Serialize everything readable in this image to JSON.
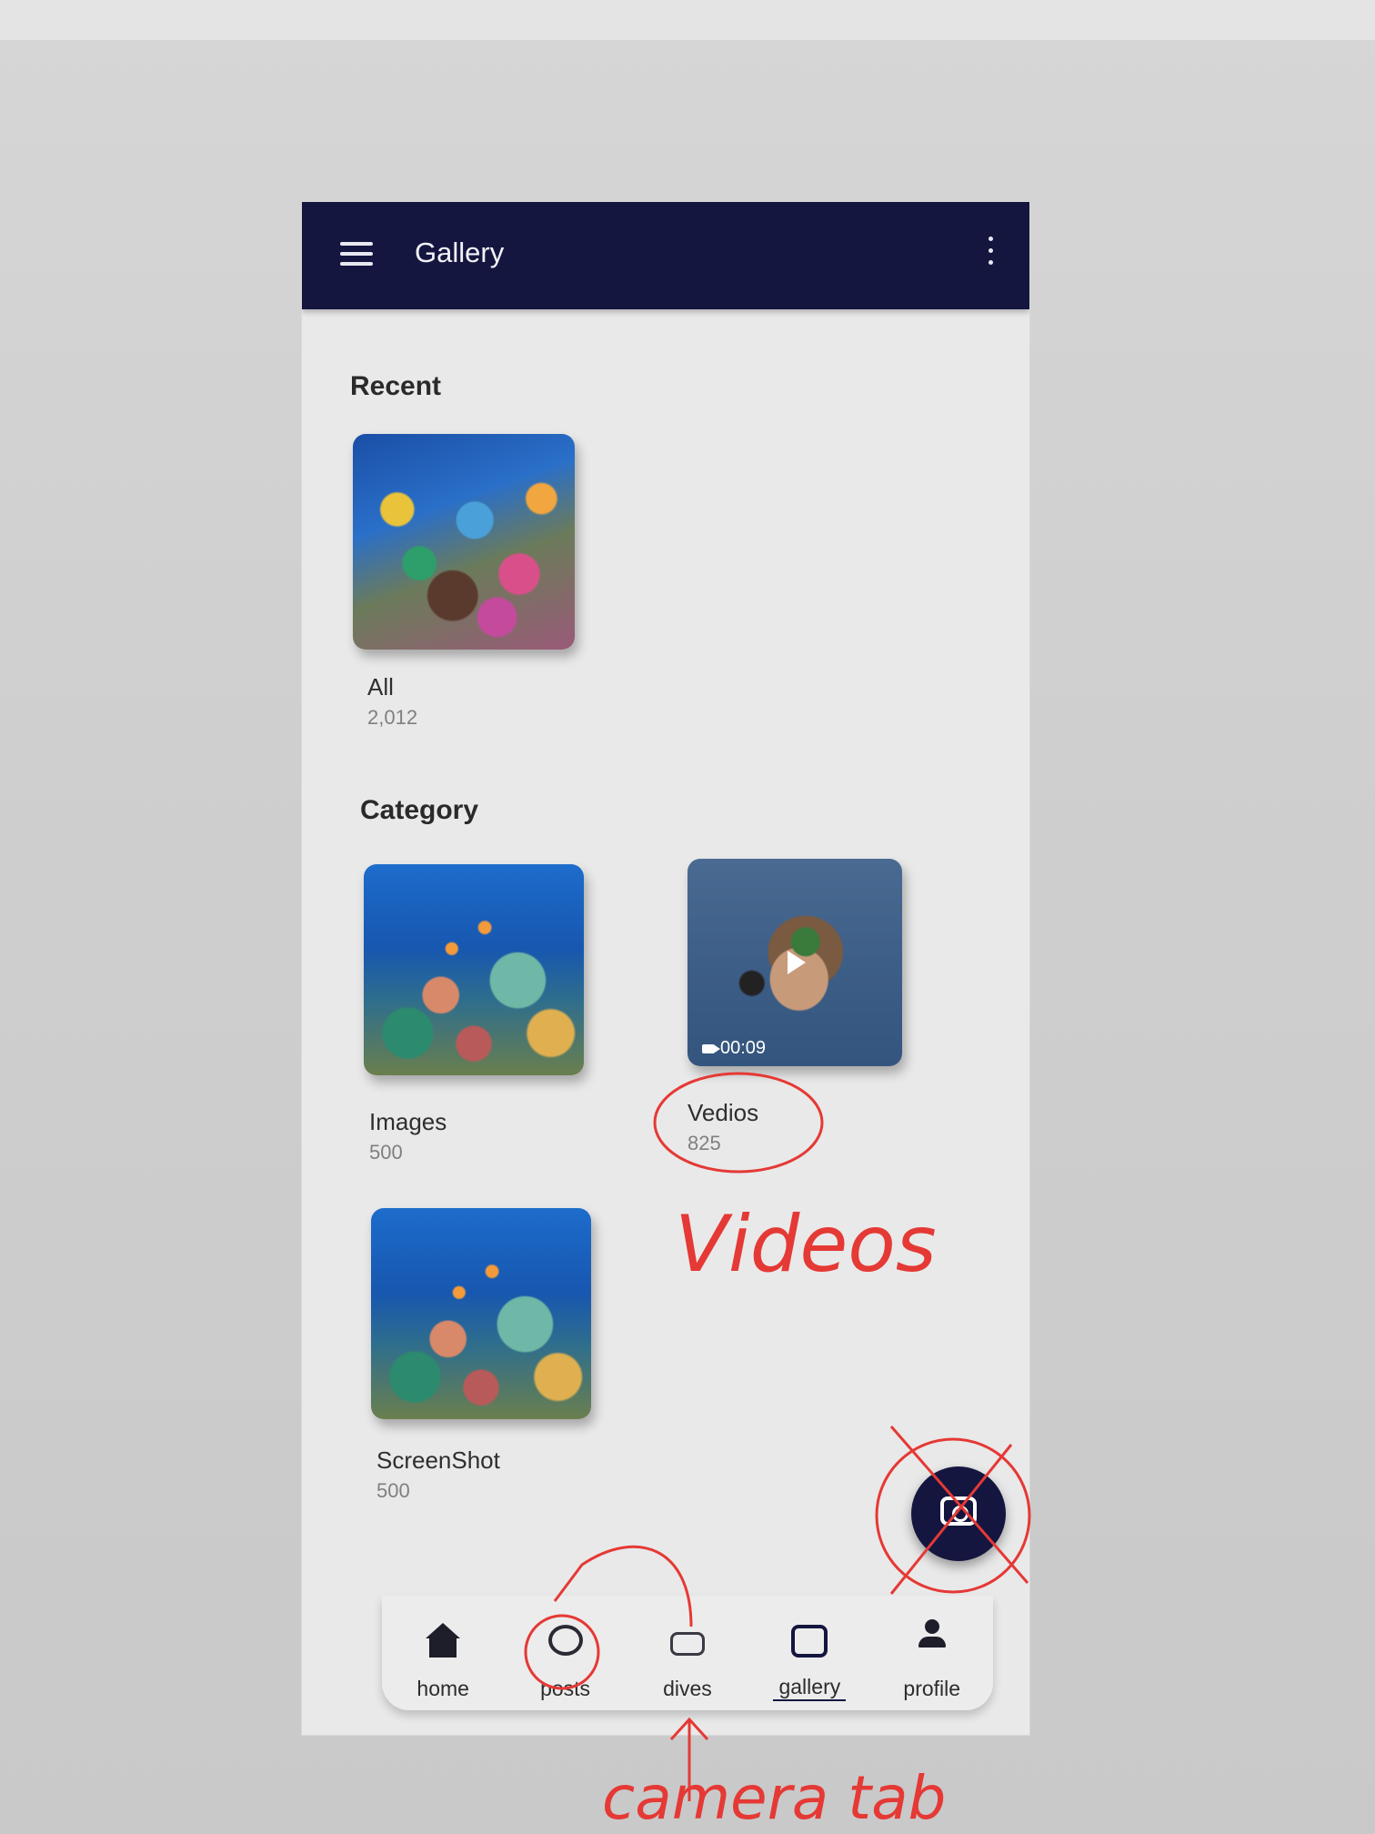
{
  "app_bar": {
    "title": "Gallery",
    "menu_icon": "hamburger-menu-icon",
    "more_icon": "vertical-dots-icon",
    "color": "#14163f"
  },
  "recent": {
    "heading": "Recent",
    "albums": [
      {
        "name": "All",
        "count": "2,012"
      }
    ]
  },
  "category": {
    "heading": "Category",
    "albums": [
      {
        "name": "Images",
        "count": "500"
      },
      {
        "name": "Vedios",
        "count": "825",
        "video_duration": "00:09"
      },
      {
        "name": "ScreenShot",
        "count": "500"
      }
    ]
  },
  "fab": {
    "icon": "camera-icon"
  },
  "bottom_nav": {
    "items": [
      {
        "label": "home",
        "icon": "home-icon"
      },
      {
        "label": "posts",
        "icon": "posts-icon"
      },
      {
        "label": "dives",
        "icon": "snorkel-icon"
      },
      {
        "label": "gallery",
        "icon": "gallery-icon",
        "active": true
      },
      {
        "label": "profile",
        "icon": "person-icon"
      }
    ]
  },
  "annotations": {
    "videos_note": "Videos",
    "camera_tab_note": "camera tab",
    "color": "#e53935"
  }
}
